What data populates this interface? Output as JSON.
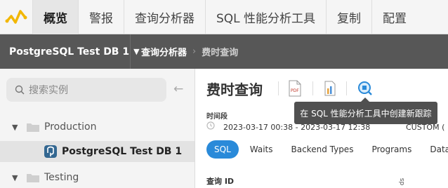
{
  "nav": {
    "tabs": [
      "概览",
      "警报",
      "查询分析器",
      "SQL 性能分析工具",
      "复制",
      "配置"
    ],
    "active_index": 0
  },
  "breadcrumb": {
    "db_selector": "PostgreSQL Test DB 1",
    "items": [
      "查询分析器",
      "费时查询"
    ]
  },
  "sidebar": {
    "search_placeholder": "搜索实例",
    "tree": [
      {
        "label": "Production",
        "type": "folder",
        "expanded": true
      },
      {
        "label": "PostgreSQL Test DB 1",
        "type": "instance",
        "selected": true
      },
      {
        "label": "Testing",
        "type": "folder",
        "expanded": true
      }
    ]
  },
  "main": {
    "title": "费时查询",
    "tooltip": "在 SQL 性能分析工具中创建新跟踪",
    "period_label": "时间段",
    "period_value": "2023-03-17 00:38  -  2023-03-17 12:38",
    "period_mode": "CUSTOM (",
    "tabs": [
      "SQL",
      "Waits",
      "Backend Types",
      "Programs",
      "Databa"
    ],
    "active_tab": 0,
    "column_header": "查询 ID",
    "partial_column": "ds"
  },
  "colors": {
    "accent": "#2a8ad9",
    "crumb_bar": "#575757",
    "logo": "#f2b705"
  }
}
